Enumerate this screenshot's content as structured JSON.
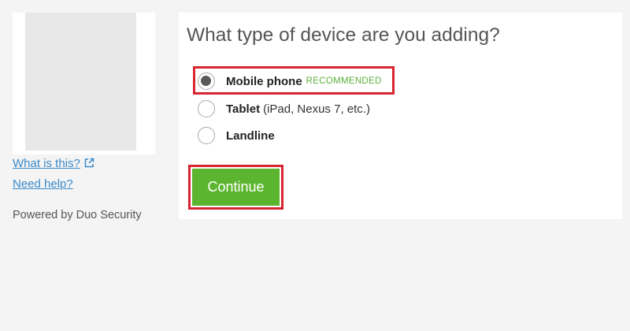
{
  "sidebar": {
    "logo_icon": "brand-logo-placeholder",
    "what_is_this_label": "What is this?",
    "external_link_icon": "external-link-icon",
    "need_help_label": "Need help?",
    "powered_by": "Powered by Duo Security"
  },
  "main": {
    "heading": "What type of device are you adding?",
    "options": [
      {
        "label": "Mobile phone",
        "note": "",
        "badge": "RECOMMENDED",
        "selected": true,
        "highlighted": true
      },
      {
        "label": "Tablet",
        "note": "(iPad, Nexus 7, etc.)",
        "badge": "",
        "selected": false
      },
      {
        "label": "Landline",
        "note": "",
        "badge": "",
        "selected": false
      }
    ],
    "continue_label": "Continue"
  },
  "colors": {
    "accent_green": "#5cb52f",
    "highlight_red": "#d7262f",
    "link_blue": "#3a8ac9",
    "recommended_green": "#5cb03b"
  }
}
